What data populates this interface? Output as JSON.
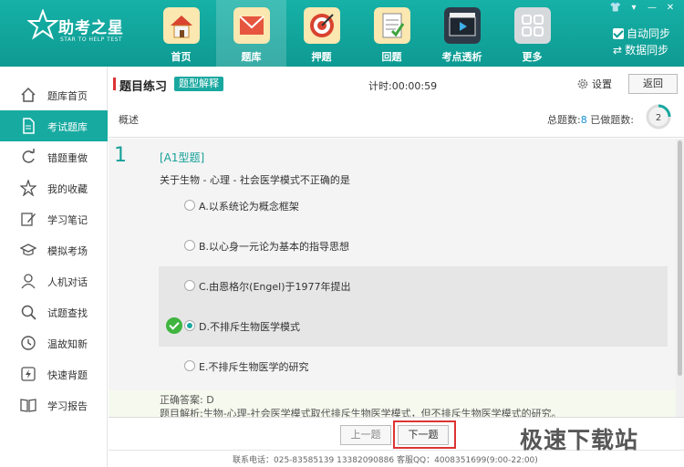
{
  "app": {
    "logo_name": "助考之星",
    "logo_slogan": "STAR TO HELP TEST"
  },
  "nav": [
    {
      "label": "首页",
      "icon": "home-icon"
    },
    {
      "label": "题库",
      "icon": "envelope-icon"
    },
    {
      "label": "押题",
      "icon": "target-icon"
    },
    {
      "label": "回题",
      "icon": "checklist-icon"
    },
    {
      "label": "考点透析",
      "icon": "film-icon"
    },
    {
      "label": "更多",
      "icon": "grid-icon"
    }
  ],
  "sync": {
    "auto": "自动同步",
    "data": "数据同步"
  },
  "sidebar": [
    {
      "label": "题库首页",
      "icon": "home-outline-icon"
    },
    {
      "label": "考试题库",
      "icon": "document-icon"
    },
    {
      "label": "错题重做",
      "icon": "refresh-icon"
    },
    {
      "label": "我的收藏",
      "icon": "star-icon"
    },
    {
      "label": "学习笔记",
      "icon": "pencil-icon"
    },
    {
      "label": "模拟考场",
      "icon": "graduation-cap-icon"
    },
    {
      "label": "人机对话",
      "icon": "person-icon"
    },
    {
      "label": "试题查找",
      "icon": "search-icon"
    },
    {
      "label": "温故知新",
      "icon": "clock-icon"
    },
    {
      "label": "快速背题",
      "icon": "lightning-icon"
    },
    {
      "label": "学习报告",
      "icon": "book-icon"
    }
  ],
  "main": {
    "title": "题目练习",
    "tag": "题型解释",
    "timer": "计时:00:00:59",
    "settings": "设置",
    "back": "返回",
    "overview": "概述",
    "total_label": "总题数:",
    "total": "8",
    "done_label": "已做题数:",
    "done": "2"
  },
  "question": {
    "number": "1",
    "type": "[A1型题]",
    "text": "关于生物 - 心理 - 社会医学模式不正确的是",
    "options": [
      "A.以系统论为概念框架",
      "B.以心身一元论为基本的指导思想",
      "C.由恩格尔(Engel)于1977年提出",
      "D.不排斥生物医学模式",
      "E.不排斥生物医学的研究"
    ],
    "selected": 3,
    "answer": "正确答案: D",
    "analysis": "题目解析:生物-心理-社会医学模式取代排斥生物医学模式，但不排斥生物医学模式的研究。"
  },
  "pager": {
    "prev": "上一题",
    "next": "下一题"
  },
  "footer": "联系电话：025-83585139   13382090886  客服QQ：4008351699(9:00-22:00)",
  "watermark": "极速下载站",
  "colors": {
    "teal": "#17aaa0",
    "highlight_red": "#dd3333",
    "correct_green": "#3fb53f"
  }
}
